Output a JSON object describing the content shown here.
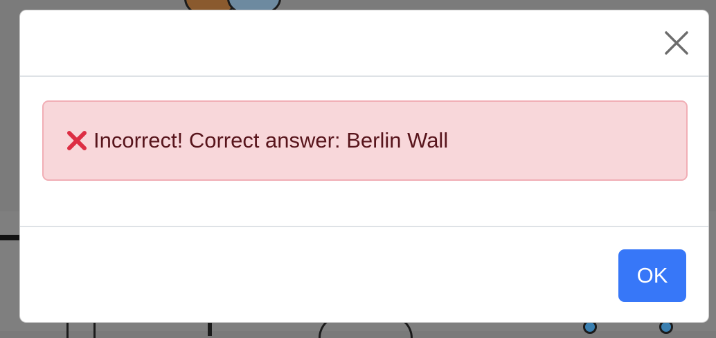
{
  "dialog": {
    "close_label": "×",
    "alert": {
      "icon": "cross-mark-icon",
      "message": "Incorrect! Correct answer: Berlin Wall"
    },
    "ok_label": "OK"
  },
  "colors": {
    "alert_bg": "#f8d7da",
    "alert_border": "#f1aeb5",
    "alert_text": "#58151c",
    "icon_red": "#dd2e44",
    "primary": "#3777f8"
  }
}
